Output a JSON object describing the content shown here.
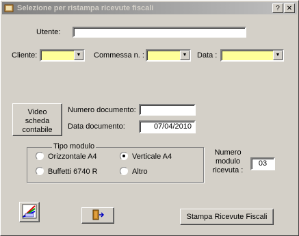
{
  "window": {
    "title": "Selezione per ristampa ricevute fiscali",
    "close_glyph": "✕",
    "help_glyph": "?"
  },
  "form": {
    "utente_label": "Utente:",
    "utente_value": "",
    "cliente_label": "Cliente:",
    "commessa_label": "Commessa  n. :",
    "data_label": "Data :",
    "combo_color": "#ffff99"
  },
  "documento": {
    "video_button_label": "Video scheda contabile",
    "numero_label": "Numero documento:",
    "numero_value": "",
    "data_label": "Data documento:",
    "data_value": "07/04/2010"
  },
  "tipo_modulo": {
    "title": "Tipo modulo",
    "options": [
      {
        "label": "Orizzontale A4",
        "selected": false
      },
      {
        "label": "Verticale A4",
        "selected": true
      },
      {
        "label": "Buffetti 6740 R",
        "selected": false
      },
      {
        "label": "Altro",
        "selected": false
      }
    ]
  },
  "numero_modulo": {
    "label": "Numero modulo ricevuta :",
    "value": "03"
  },
  "footer": {
    "chart_icon": "chart-icon",
    "exit_icon": "exit-door-icon",
    "print_button_label": "Stampa Ricevute Fiscali"
  }
}
